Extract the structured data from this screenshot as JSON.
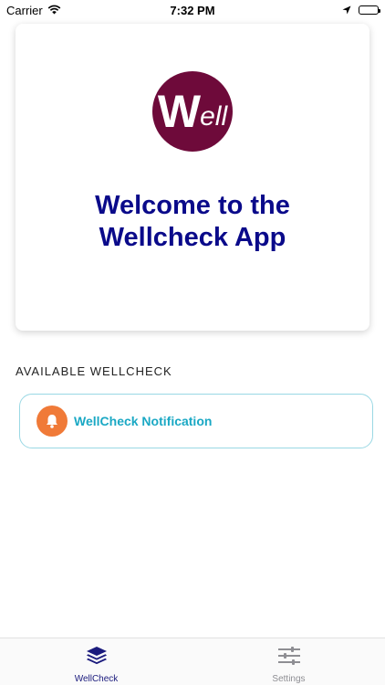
{
  "status_bar": {
    "carrier": "Carrier",
    "time": "7:32 PM"
  },
  "hero": {
    "logo_big_letter": "W",
    "logo_small_letters": "ell",
    "title_line1": "Welcome to the",
    "title_line2": "Wellcheck App"
  },
  "section": {
    "label": "AVAILABLE WELLCHECK"
  },
  "wellchecks": [
    {
      "label": "WellCheck Notification",
      "icon": "bell-icon"
    }
  ],
  "tabs": [
    {
      "label": "WellCheck",
      "icon": "layers-icon",
      "active": true
    },
    {
      "label": "Settings",
      "icon": "sliders-icon",
      "active": false
    }
  ],
  "colors": {
    "logo_bg": "#6e0a3a",
    "title": "#0a0a8a",
    "accent": "#1aa8c4",
    "bell_bg": "#f07a38",
    "tab_active": "#1b1b7d",
    "tab_inactive": "#8e8e93"
  }
}
